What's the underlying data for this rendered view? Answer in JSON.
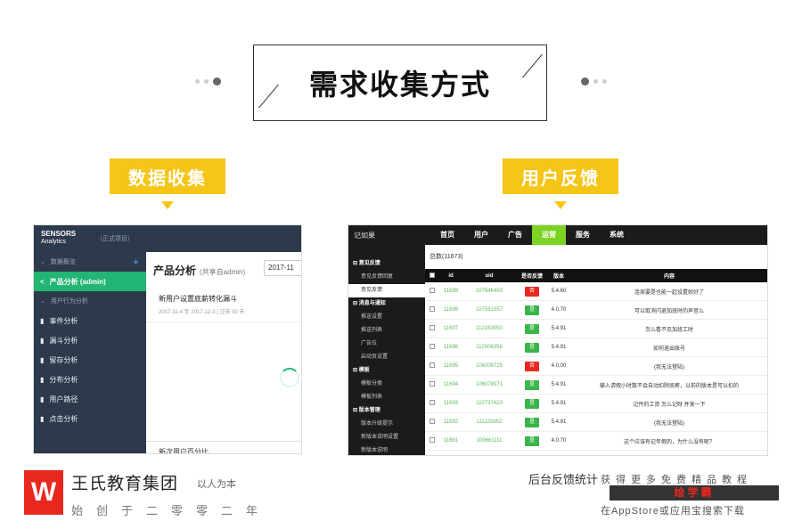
{
  "title": "需求收集方式",
  "tags": {
    "left": "数据收集",
    "right": "用户反馈"
  },
  "left_shot": {
    "logo_line1": "SENSORS",
    "logo_line2": "Analytics",
    "project": "（正式项目）",
    "sidebar": [
      {
        "label": "数据概览",
        "type": "section",
        "plus": "+"
      },
      {
        "label": "产品分析 (admin)",
        "type": "active"
      },
      {
        "label": "用户行为分析",
        "type": "section"
      },
      {
        "label": "事件分析",
        "type": "item"
      },
      {
        "label": "漏斗分析",
        "type": "item"
      },
      {
        "label": "留存分析",
        "type": "item"
      },
      {
        "label": "分布分析",
        "type": "item"
      },
      {
        "label": "用户路径",
        "type": "item"
      },
      {
        "label": "点击分析",
        "type": "item"
      }
    ],
    "heading": "产品分析",
    "heading_sub": "(共享自admin)",
    "date": "2017-11",
    "card_title": "新用户设置底薪转化漏斗",
    "card_sub": "2017-11-4 至 2017-12-3 | 过去 30 天",
    "footer": "新次用户百分比"
  },
  "right_shot": {
    "brand": "记如果",
    "nav": [
      "首页",
      "用户",
      "广告",
      "运营",
      "服务",
      "系统"
    ],
    "nav_active": 3,
    "sidebar": [
      {
        "label": "意见反馈",
        "type": "sec"
      },
      {
        "label": "意见反馈回复",
        "type": "item"
      },
      {
        "label": "意见反馈",
        "type": "active"
      },
      {
        "label": "消息与通知",
        "type": "sec"
      },
      {
        "label": "推送设置",
        "type": "item"
      },
      {
        "label": "推送列表",
        "type": "item"
      },
      {
        "label": "广告位",
        "type": "item"
      },
      {
        "label": "启动页设置",
        "type": "item"
      },
      {
        "label": "模板",
        "type": "sec"
      },
      {
        "label": "模板分类",
        "type": "item"
      },
      {
        "label": "模板列表",
        "type": "item"
      },
      {
        "label": "版本管理",
        "type": "sec"
      },
      {
        "label": "版本升级提示",
        "type": "item"
      },
      {
        "label": "新版本说明设置",
        "type": "item"
      },
      {
        "label": "新版本说明",
        "type": "item"
      }
    ],
    "count": "总数(11673)",
    "columns": [
      "",
      "id",
      "uid",
      "是否反馈",
      "版本",
      "内容"
    ],
    "rows": [
      {
        "id": "11699",
        "uid": "107846493",
        "flag": "red",
        "flag_text": "否",
        "version": "5.4.60",
        "content": "连周要是也能一起设置就好了"
      },
      {
        "id": "11698",
        "uid": "107551557",
        "flag": "green",
        "flag_text": "是",
        "version": "4.0.70",
        "content": "可以取消闪退加班时的声音么"
      },
      {
        "id": "11697",
        "uid": "112163050",
        "flag": "green",
        "flag_text": "是",
        "version": "5.4.91",
        "content": "怎么看不见加班工时"
      },
      {
        "id": "11696",
        "uid": "112006356",
        "flag": "green",
        "flag_text": "是",
        "version": "5.4.91",
        "content": "如何退出账号"
      },
      {
        "id": "11695",
        "uid": "106008729",
        "flag": "red",
        "flag_text": "否",
        "version": "4.0.00",
        "content": "(我无法登陆)"
      },
      {
        "id": "11694",
        "uid": "106078071",
        "flag": "green",
        "flag_text": "是",
        "version": "5.4.91",
        "content": "输入请假小时数不会自动扣除底薪，以前的版本是可以扣的"
      },
      {
        "id": "11693",
        "uid": "110737423",
        "flag": "green",
        "flag_text": "是",
        "version": "5.4.91",
        "content": "记件的工资 怎么记呀 并发一下"
      },
      {
        "id": "11692",
        "uid": "111125852",
        "flag": "green",
        "flag_text": "是",
        "version": "5.4.91",
        "content": "(我无法登陆)"
      },
      {
        "id": "11691",
        "uid": "109661111",
        "flag": "green",
        "flag_text": "是",
        "version": "4.0.70",
        "content": "这个应该有记年假的，为什么没有呢？"
      }
    ]
  },
  "caption_right": "后台反馈统计",
  "watermark_right": {
    "line1": "获得更多免费精品教程",
    "line2": "绘学霸",
    "line3": "在AppStore或应用宝搜索下载"
  },
  "watermark_left": {
    "logo": "W",
    "line1": "王氏教育集团",
    "line1b": "以人为本",
    "line2": "始创于二零零二年"
  }
}
